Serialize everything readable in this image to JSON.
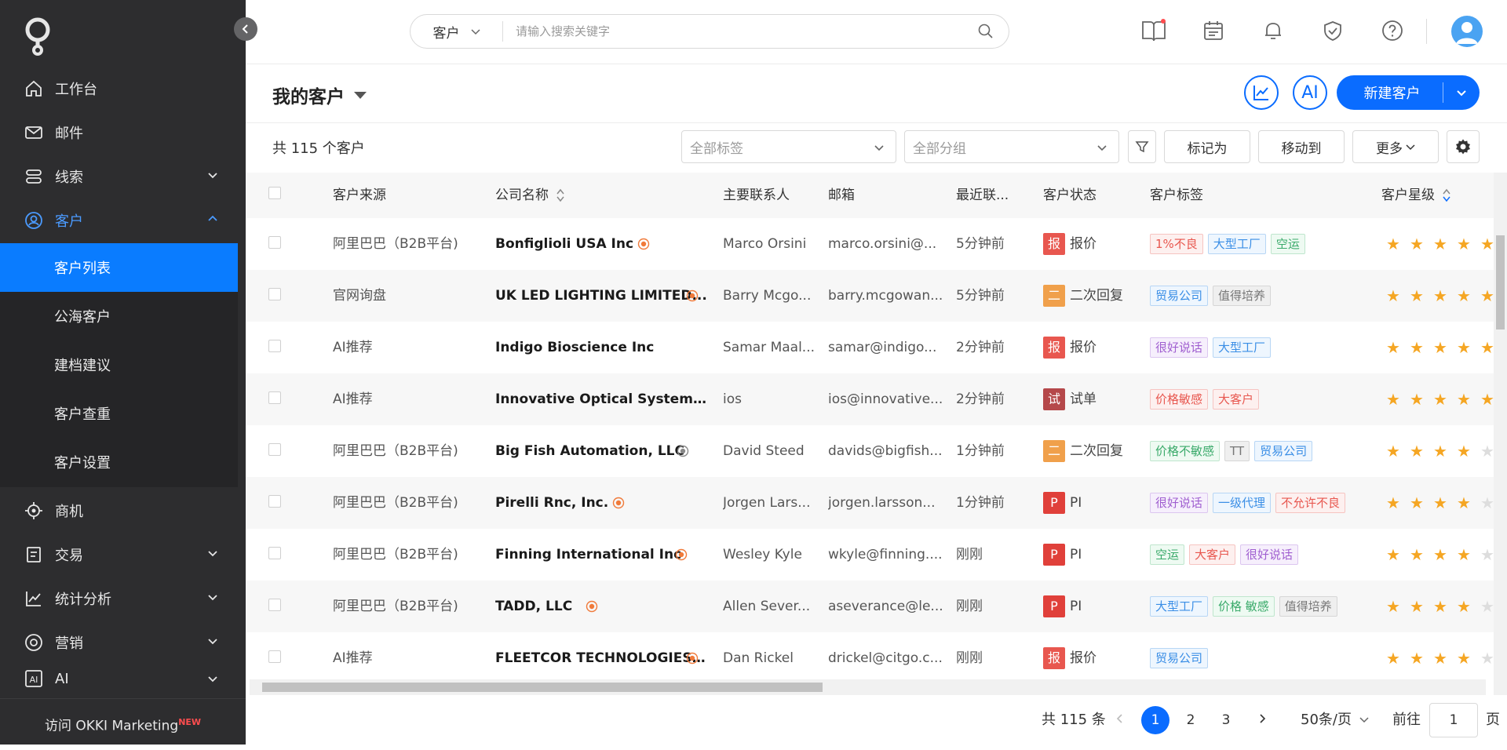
{
  "sidebar": {
    "items": [
      {
        "label": "工作台",
        "icon": "home-icon"
      },
      {
        "label": "邮件",
        "icon": "mail-icon"
      },
      {
        "label": "线索",
        "icon": "leads-icon"
      },
      {
        "label": "客户",
        "icon": "customer-icon"
      },
      {
        "label": "商机",
        "icon": "opportunity-icon"
      },
      {
        "label": "交易",
        "icon": "deal-icon"
      },
      {
        "label": "统计分析",
        "icon": "chart-icon"
      },
      {
        "label": "营销",
        "icon": "marketing-icon"
      },
      {
        "label": "AI",
        "icon": "ai-icon"
      }
    ],
    "sub_items": [
      "客户列表",
      "公海客户",
      "建档建议",
      "客户查重",
      "客户设置"
    ],
    "okki_label": "访问 OKKI Marketing",
    "okki_badge": "NEW"
  },
  "search": {
    "scope": "客户",
    "placeholder": "请输入搜索关键字"
  },
  "header": {
    "title": "我的客户",
    "ai_label": "AI",
    "new_button": "新建客户"
  },
  "filters": {
    "count": "共 115 个客户",
    "tags_placeholder": "全部标签",
    "group_placeholder": "全部分组",
    "mark_as": "标记为",
    "move_to": "移动到",
    "more": "更多"
  },
  "table": {
    "columns": [
      "客户来源",
      "公司名称",
      "主要联系人",
      "邮箱",
      "最近联...",
      "客户状态",
      "客户标签",
      "客户星级"
    ],
    "rows": [
      {
        "source": "阿里巴巴（B2B平台)",
        "company": "Bonfiglioli USA Inc",
        "dot": "orange",
        "contact": "Marco Orsini",
        "email": "marco.orsini@...",
        "recent": "5分钟前",
        "status_char": "报",
        "status": "报价",
        "status_color": "#e8574f",
        "tags": [
          [
            "1%不良",
            "red"
          ],
          [
            "大型工厂",
            "blue"
          ],
          [
            "空运",
            "green"
          ]
        ],
        "stars": 5
      },
      {
        "source": "官网询盘",
        "company": "UK LED LIGHTING LIMITED...",
        "dot": "orange",
        "contact": "Barry Mcgo...",
        "email": "barry.mcgowan...",
        "recent": "5分钟前",
        "status_char": "二",
        "status": "二次回复",
        "status_color": "#f0a04b",
        "tags": [
          [
            "贸易公司",
            "blue"
          ],
          [
            "值得培养",
            "gray"
          ]
        ],
        "stars": 5
      },
      {
        "source": "AI推荐",
        "company": "Indigo Bioscience Inc",
        "dot": "",
        "contact": "Samar Maal...",
        "email": "samar@indigo...",
        "recent": "2分钟前",
        "status_char": "报",
        "status": "报价",
        "status_color": "#e8574f",
        "tags": [
          [
            "很好说话",
            "purple"
          ],
          [
            "大型工厂",
            "blue"
          ]
        ],
        "stars": 5
      },
      {
        "source": "AI推荐",
        "company": "Innovative Optical Systems Inc...",
        "dot": "",
        "contact": "ios",
        "email": "ios@innovative...",
        "recent": "2分钟前",
        "status_char": "试",
        "status": "试单",
        "status_color": "#b5484a",
        "tags": [
          [
            "价格敏感",
            "red"
          ],
          [
            "大客户",
            "red"
          ]
        ],
        "stars": 5
      },
      {
        "source": "阿里巴巴（B2B平台)",
        "company": "Big Fish Automation, LLC",
        "dot": "gray",
        "contact": "David Steed",
        "email": "davids@bigfish...",
        "recent": "1分钟前",
        "status_char": "二",
        "status": "二次回复",
        "status_color": "#f0a04b",
        "tags": [
          [
            "价格不敏感",
            "green"
          ],
          [
            "TT",
            "gray"
          ],
          [
            "贸易公司",
            "blue"
          ]
        ],
        "stars": 4
      },
      {
        "source": "阿里巴巴（B2B平台)",
        "company": "Pirelli Rnc, Inc.",
        "dot": "orange",
        "contact": "Jorgen Lars...",
        "email": "jorgen.larsson...",
        "recent": "1分钟前",
        "status_char": "P",
        "status": "PI",
        "status_color": "#e0403a",
        "tags": [
          [
            "很好说话",
            "purple"
          ],
          [
            "一级代理",
            "blue"
          ],
          [
            "不允许不良",
            "red"
          ]
        ],
        "stars": 4
      },
      {
        "source": "阿里巴巴（B2B平台)",
        "company": "Finning International Inc",
        "dot": "orange",
        "contact": "Wesley Kyle",
        "email": "wkyle@finning....",
        "recent": "刚刚",
        "status_char": "P",
        "status": "PI",
        "status_color": "#e0403a",
        "tags": [
          [
            "空运",
            "green"
          ],
          [
            "大客户",
            "red"
          ],
          [
            "很好说话",
            "purple"
          ]
        ],
        "stars": 4
      },
      {
        "source": "阿里巴巴（B2B平台)",
        "company": "TADD, LLC",
        "dot": "orange",
        "contact": "Allen Sever...",
        "email": "aseverance@le...",
        "recent": "刚刚",
        "status_char": "P",
        "status": "PI",
        "status_color": "#e0403a",
        "tags": [
          [
            "大型工厂",
            "blue"
          ],
          [
            "价格 敏感",
            "green"
          ],
          [
            "值得培养",
            "gray"
          ]
        ],
        "stars": 4
      },
      {
        "source": "AI推荐",
        "company": "FLEETCOR TECHNOLOGIES,...",
        "dot": "orange",
        "contact": "Dan Rickel",
        "email": "drickel@citgo.c...",
        "recent": "刚刚",
        "status_char": "报",
        "status": "报价",
        "status_color": "#e8574f",
        "tags": [
          [
            "贸易公司",
            "blue"
          ]
        ],
        "stars": 4
      }
    ]
  },
  "pagination": {
    "total": "共 115 条",
    "pages": [
      "1",
      "2",
      "3"
    ],
    "page_size": "50条/页",
    "goto_label": "前往",
    "goto_value": "1",
    "page_unit": "页"
  },
  "colors": {
    "primary": "#0a6cff",
    "sidebar_bg": "#2d2d2f",
    "star": "#f5a623"
  }
}
